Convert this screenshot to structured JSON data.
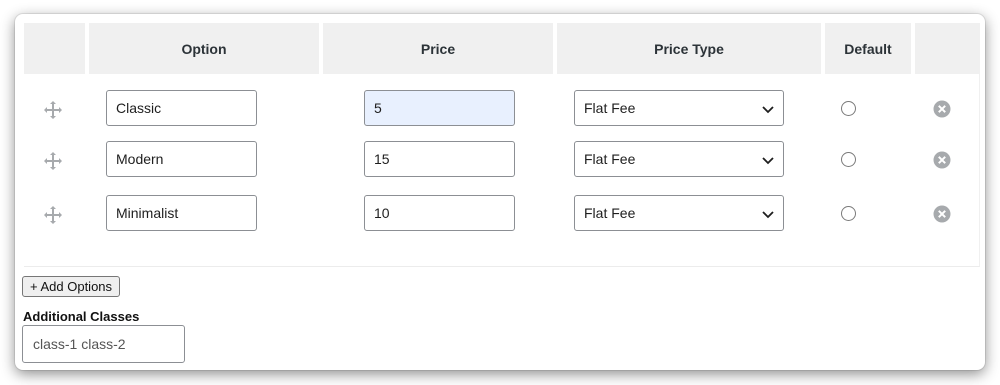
{
  "table": {
    "headers": [
      "",
      "Option",
      "Price",
      "Price Type",
      "Default",
      ""
    ],
    "rows": [
      {
        "option": "Classic",
        "price": "5",
        "price_type": "Flat Fee",
        "default": false,
        "price_focused": true
      },
      {
        "option": "Modern",
        "price": "15",
        "price_type": "Flat Fee",
        "default": false
      },
      {
        "option": "Minimalist",
        "price": "10",
        "price_type": "Flat Fee",
        "default": false
      }
    ]
  },
  "add_options_label": "+ Add Options",
  "additional_classes": {
    "label": "Additional Classes",
    "value": "class-1 class-2"
  },
  "icons": {
    "drag": "move-arrows-icon",
    "chevron": "chevron-down-icon",
    "remove": "remove-circle-x-icon"
  },
  "colors": {
    "header_bg": "#f0f0f0",
    "focused_input_bg": "#e8f0fe",
    "border": "#8c8f94",
    "icon_gray": "#a7aaad"
  }
}
